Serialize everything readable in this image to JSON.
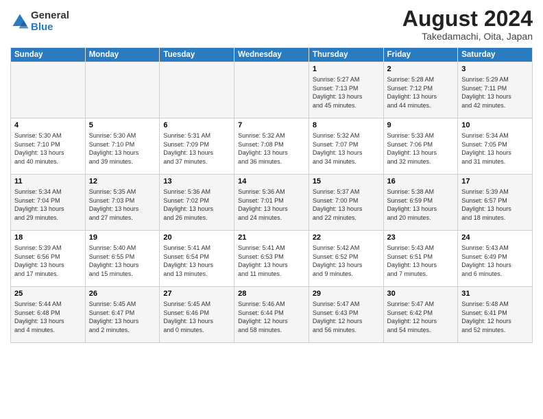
{
  "header": {
    "logo_line1": "General",
    "logo_line2": "Blue",
    "month_year": "August 2024",
    "location": "Takedamachi, Oita, Japan"
  },
  "days_of_week": [
    "Sunday",
    "Monday",
    "Tuesday",
    "Wednesday",
    "Thursday",
    "Friday",
    "Saturday"
  ],
  "weeks": [
    [
      {
        "day": "",
        "info": ""
      },
      {
        "day": "",
        "info": ""
      },
      {
        "day": "",
        "info": ""
      },
      {
        "day": "",
        "info": ""
      },
      {
        "day": "1",
        "info": "Sunrise: 5:27 AM\nSunset: 7:13 PM\nDaylight: 13 hours\nand 45 minutes."
      },
      {
        "day": "2",
        "info": "Sunrise: 5:28 AM\nSunset: 7:12 PM\nDaylight: 13 hours\nand 44 minutes."
      },
      {
        "day": "3",
        "info": "Sunrise: 5:29 AM\nSunset: 7:11 PM\nDaylight: 13 hours\nand 42 minutes."
      }
    ],
    [
      {
        "day": "4",
        "info": "Sunrise: 5:30 AM\nSunset: 7:10 PM\nDaylight: 13 hours\nand 40 minutes."
      },
      {
        "day": "5",
        "info": "Sunrise: 5:30 AM\nSunset: 7:10 PM\nDaylight: 13 hours\nand 39 minutes."
      },
      {
        "day": "6",
        "info": "Sunrise: 5:31 AM\nSunset: 7:09 PM\nDaylight: 13 hours\nand 37 minutes."
      },
      {
        "day": "7",
        "info": "Sunrise: 5:32 AM\nSunset: 7:08 PM\nDaylight: 13 hours\nand 36 minutes."
      },
      {
        "day": "8",
        "info": "Sunrise: 5:32 AM\nSunset: 7:07 PM\nDaylight: 13 hours\nand 34 minutes."
      },
      {
        "day": "9",
        "info": "Sunrise: 5:33 AM\nSunset: 7:06 PM\nDaylight: 13 hours\nand 32 minutes."
      },
      {
        "day": "10",
        "info": "Sunrise: 5:34 AM\nSunset: 7:05 PM\nDaylight: 13 hours\nand 31 minutes."
      }
    ],
    [
      {
        "day": "11",
        "info": "Sunrise: 5:34 AM\nSunset: 7:04 PM\nDaylight: 13 hours\nand 29 minutes."
      },
      {
        "day": "12",
        "info": "Sunrise: 5:35 AM\nSunset: 7:03 PM\nDaylight: 13 hours\nand 27 minutes."
      },
      {
        "day": "13",
        "info": "Sunrise: 5:36 AM\nSunset: 7:02 PM\nDaylight: 13 hours\nand 26 minutes."
      },
      {
        "day": "14",
        "info": "Sunrise: 5:36 AM\nSunset: 7:01 PM\nDaylight: 13 hours\nand 24 minutes."
      },
      {
        "day": "15",
        "info": "Sunrise: 5:37 AM\nSunset: 7:00 PM\nDaylight: 13 hours\nand 22 minutes."
      },
      {
        "day": "16",
        "info": "Sunrise: 5:38 AM\nSunset: 6:59 PM\nDaylight: 13 hours\nand 20 minutes."
      },
      {
        "day": "17",
        "info": "Sunrise: 5:39 AM\nSunset: 6:57 PM\nDaylight: 13 hours\nand 18 minutes."
      }
    ],
    [
      {
        "day": "18",
        "info": "Sunrise: 5:39 AM\nSunset: 6:56 PM\nDaylight: 13 hours\nand 17 minutes."
      },
      {
        "day": "19",
        "info": "Sunrise: 5:40 AM\nSunset: 6:55 PM\nDaylight: 13 hours\nand 15 minutes."
      },
      {
        "day": "20",
        "info": "Sunrise: 5:41 AM\nSunset: 6:54 PM\nDaylight: 13 hours\nand 13 minutes."
      },
      {
        "day": "21",
        "info": "Sunrise: 5:41 AM\nSunset: 6:53 PM\nDaylight: 13 hours\nand 11 minutes."
      },
      {
        "day": "22",
        "info": "Sunrise: 5:42 AM\nSunset: 6:52 PM\nDaylight: 13 hours\nand 9 minutes."
      },
      {
        "day": "23",
        "info": "Sunrise: 5:43 AM\nSunset: 6:51 PM\nDaylight: 13 hours\nand 7 minutes."
      },
      {
        "day": "24",
        "info": "Sunrise: 5:43 AM\nSunset: 6:49 PM\nDaylight: 13 hours\nand 6 minutes."
      }
    ],
    [
      {
        "day": "25",
        "info": "Sunrise: 5:44 AM\nSunset: 6:48 PM\nDaylight: 13 hours\nand 4 minutes."
      },
      {
        "day": "26",
        "info": "Sunrise: 5:45 AM\nSunset: 6:47 PM\nDaylight: 13 hours\nand 2 minutes."
      },
      {
        "day": "27",
        "info": "Sunrise: 5:45 AM\nSunset: 6:46 PM\nDaylight: 13 hours\nand 0 minutes."
      },
      {
        "day": "28",
        "info": "Sunrise: 5:46 AM\nSunset: 6:44 PM\nDaylight: 12 hours\nand 58 minutes."
      },
      {
        "day": "29",
        "info": "Sunrise: 5:47 AM\nSunset: 6:43 PM\nDaylight: 12 hours\nand 56 minutes."
      },
      {
        "day": "30",
        "info": "Sunrise: 5:47 AM\nSunset: 6:42 PM\nDaylight: 12 hours\nand 54 minutes."
      },
      {
        "day": "31",
        "info": "Sunrise: 5:48 AM\nSunset: 6:41 PM\nDaylight: 12 hours\nand 52 minutes."
      }
    ]
  ]
}
